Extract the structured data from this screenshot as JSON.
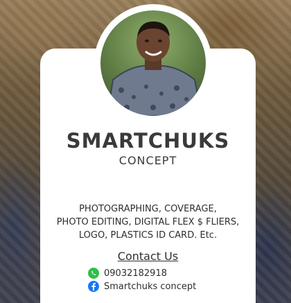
{
  "brand": {
    "name": "SMARTCHUKS",
    "sub": "CONCEPT"
  },
  "services": [
    "PHOTOGRAPHING, COVERAGE,",
    "PHOTO EDITING, DIGITAL FLEX $ FLIERS,",
    "LOGO, PLASTICS ID CARD. Etc."
  ],
  "contact": {
    "title": "Contact Us",
    "phone": "09032182918",
    "facebook": "Smartchuks concept"
  },
  "icons": {
    "phone": "whatsapp-icon",
    "facebook": "facebook-icon"
  },
  "colors": {
    "card": "#ffffff",
    "text": "#3a3a3a",
    "whatsapp": "#2fbf4a",
    "facebook": "#1877f2"
  }
}
